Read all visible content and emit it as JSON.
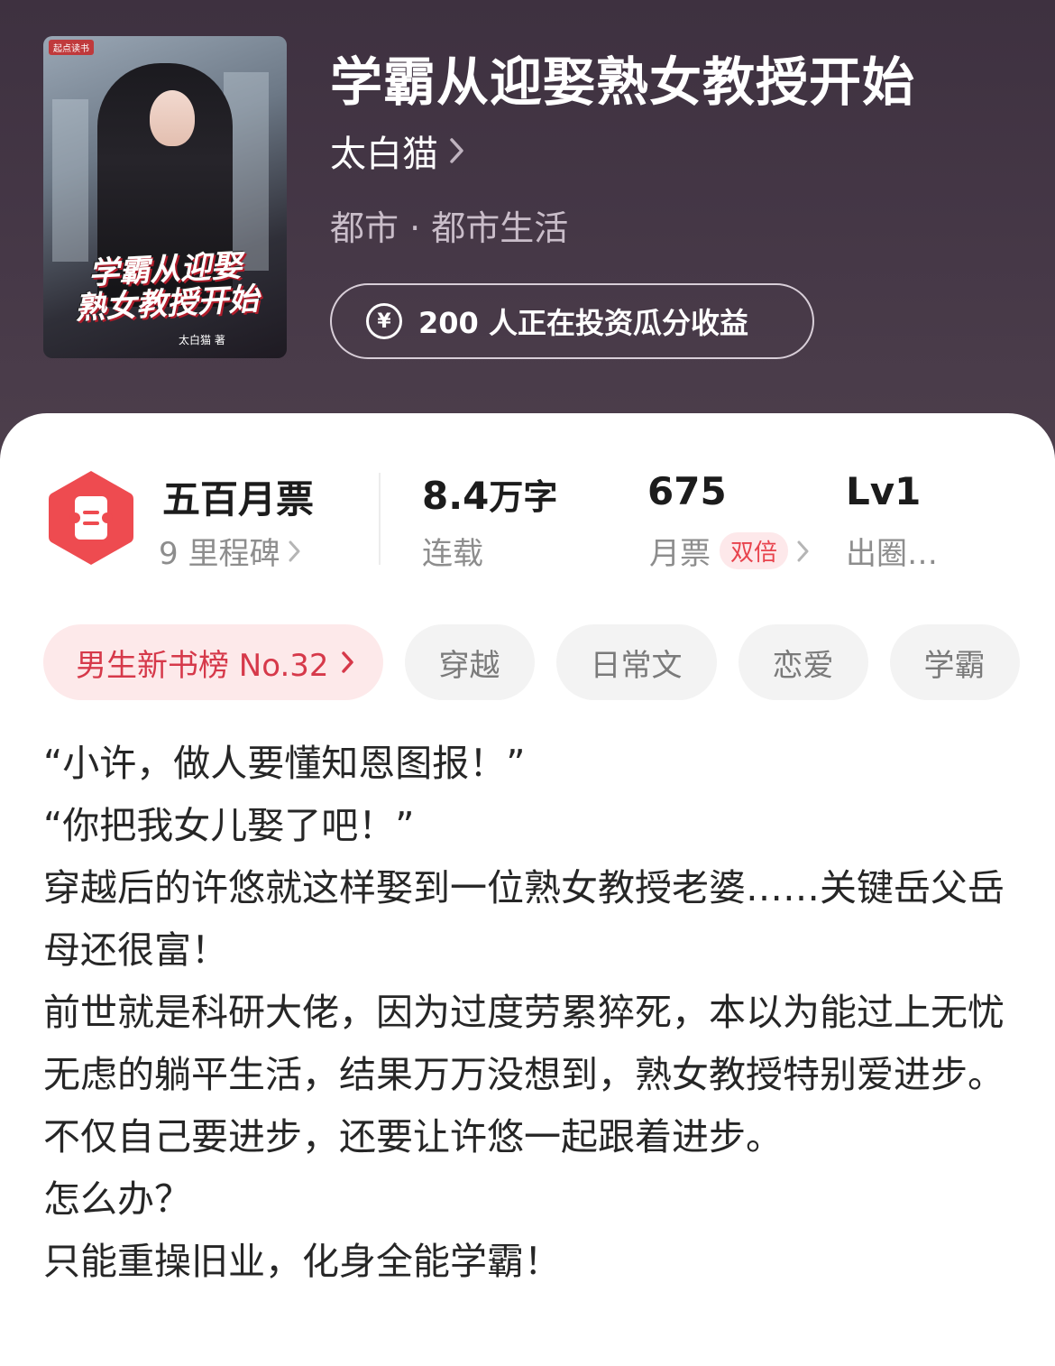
{
  "book": {
    "title": "学霸从迎娶熟女教授开始",
    "author": "太白猫",
    "genre": "都市 · 都市生活",
    "invest_text": "200 人正在投资瓜分收益"
  },
  "cover": {
    "badge": "起点读书",
    "title_line1": "学霸从迎娶",
    "title_line2": "熟女教授开始",
    "author": "太白猫 著"
  },
  "stats": {
    "ticket": {
      "main": "五百月票",
      "sub": "9 里程碑"
    },
    "words": {
      "number": "8.4",
      "unit": "万字",
      "sub": "连载"
    },
    "monthly": {
      "main": "675",
      "sub": "月票",
      "tag": "双倍"
    },
    "level": {
      "main": "Lv1",
      "sub": "出圈…"
    }
  },
  "tags": {
    "rank": "男生新书榜 No.32",
    "items": [
      "穿越",
      "日常文",
      "恋爱",
      "学霸"
    ]
  },
  "synopsis": [
    "“小许，做人要懂知恩图报！”",
    "“你把我女儿娶了吧！”",
    "穿越后的许悠就这样娶到一位熟女教授老婆……关键岳父岳母还很富！",
    "前世就是科研大佬，因为过度劳累猝死，本以为能过上无忧无虑的躺平生活，结果万万没想到，熟女教授特别爱进步。",
    "不仅自己要进步，还要让许悠一起跟着进步。",
    "怎么办？",
    "只能重操旧业，化身全能学霸！"
  ],
  "colors": {
    "header_bg": "#463847",
    "accent_red": "#e8434d",
    "rank_tag_bg": "#fde9ea"
  }
}
